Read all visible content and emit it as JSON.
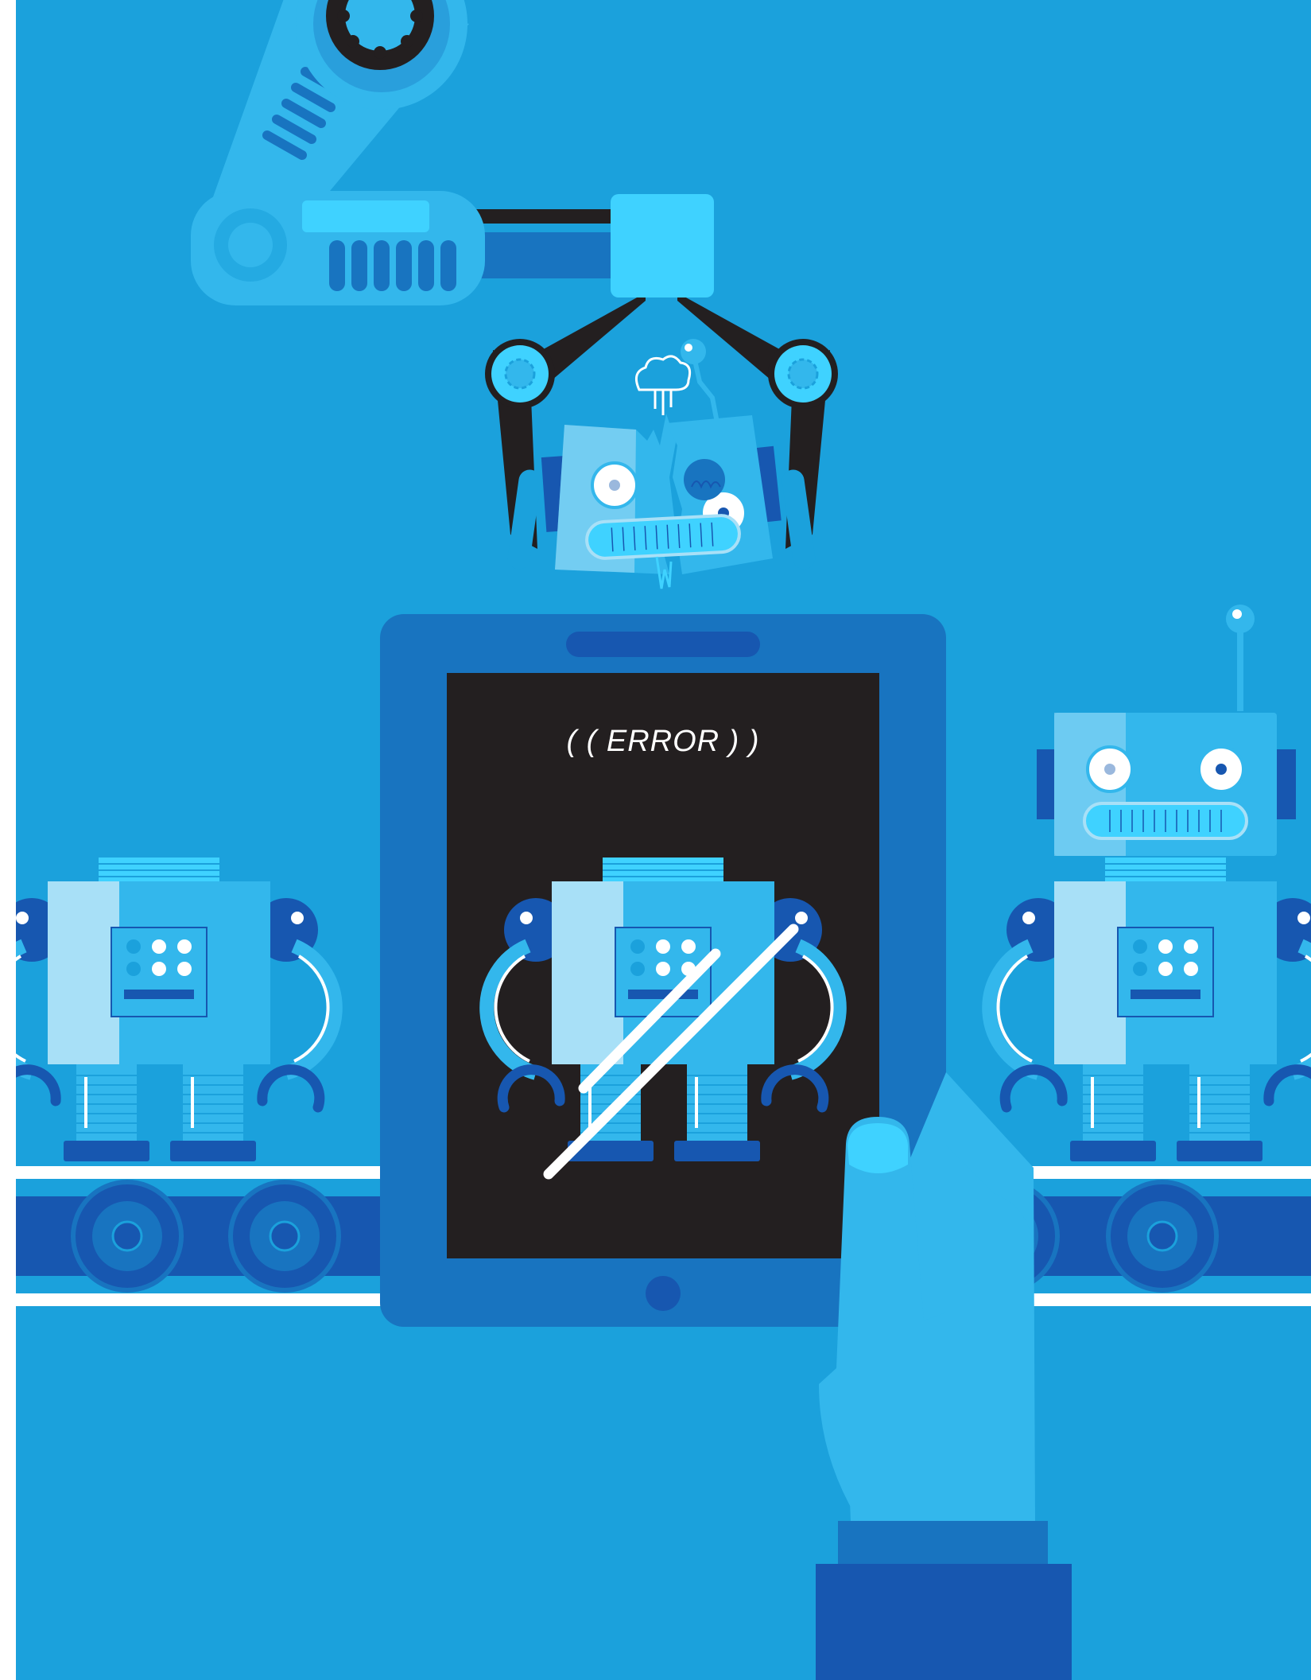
{
  "screen": {
    "message": "( ( ERROR ) )"
  },
  "icons": {
    "robotic_arm": "robotic-arm-icon",
    "claw": "claw-gripper-icon",
    "broken_robot_head": "broken-robot-head-icon",
    "tablet": "tablet-icon",
    "hand": "hand-icon",
    "conveyor": "conveyor-belt-icon",
    "robot": "robot-icon",
    "slash": "slash-error-icon"
  },
  "colors": {
    "background": "#1BA1DC",
    "light_blue": "#33B7EC",
    "cyan": "#3FD2FF",
    "tablet_frame": "#1874C0",
    "dark_blue": "#1757B0",
    "screen": "#231F20",
    "white": "#FFFFFF"
  }
}
